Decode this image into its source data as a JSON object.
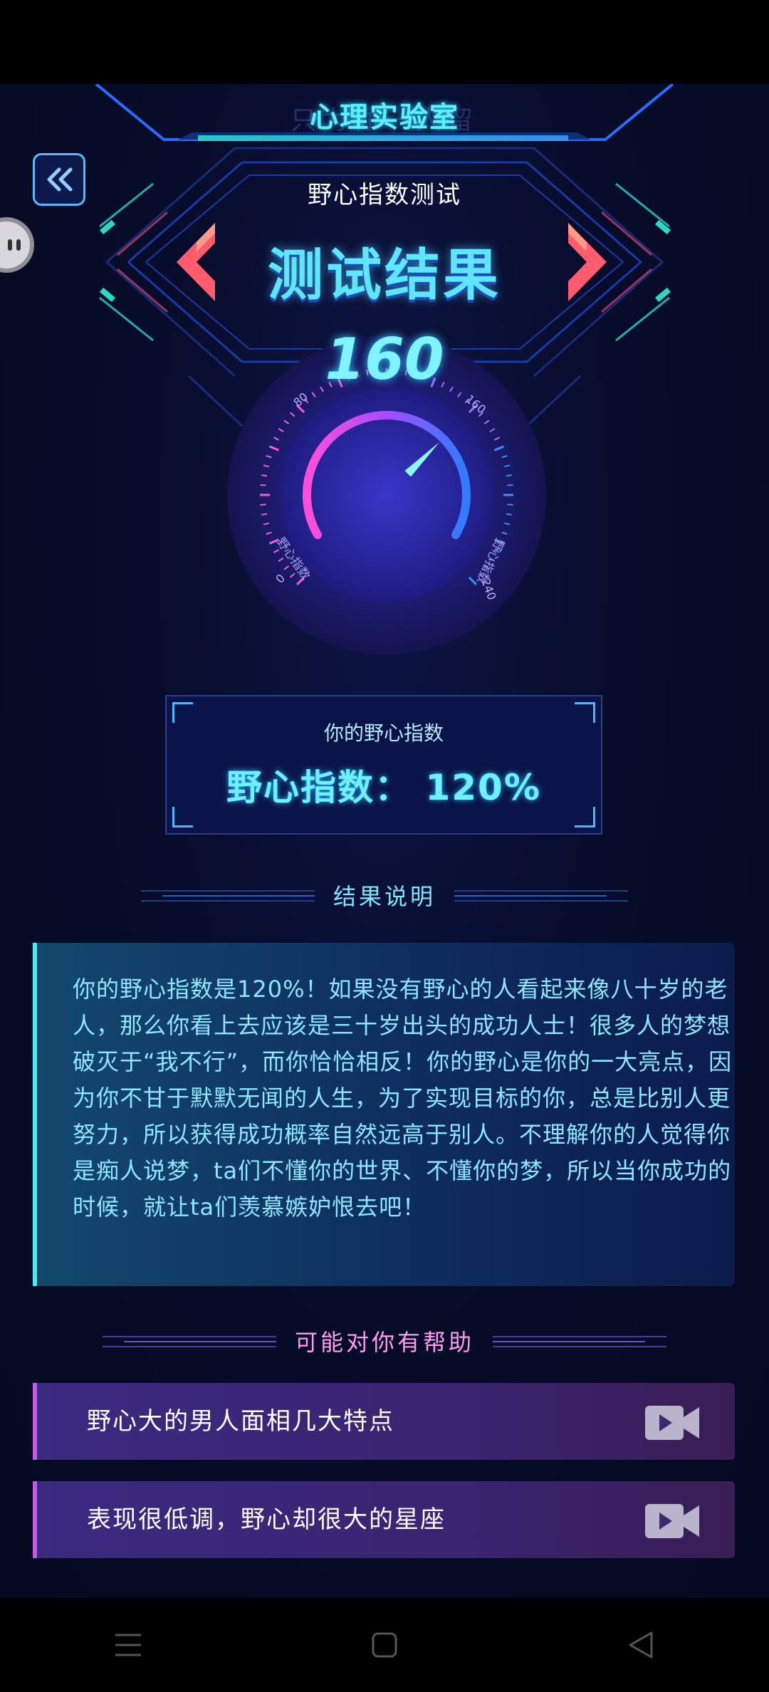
{
  "header": {
    "lab_title": "心理实验室",
    "lab_ghost": "只为你一人留",
    "test_name": "野心指数测试",
    "result_title": "测试结果"
  },
  "icons": {
    "back": "double-chevron-left-icon",
    "prev": "chevron-left-icon",
    "next": "chevron-right-icon",
    "video": "video-icon"
  },
  "gauge": {
    "value": "160",
    "tick_labels": [
      "0",
      "80",
      "160",
      "240"
    ],
    "left_caption": "野心指数",
    "right_caption": "野心指数",
    "needle_value": 160,
    "max": 240
  },
  "index_box": {
    "label": "你的野心指数",
    "value": "野心指数： 120%"
  },
  "result_section": {
    "heading": "结果说明",
    "text": "你的野心指数是120%！如果没有野心的人看起来像八十岁的老人，那么你看上去应该是三十岁出头的成功人士！很多人的梦想破灭于“我不行”，而你恰恰相反！你的野心是你的一大亮点，因为你不甘于默默无闻的人生，为了实现目标的你，总是比别人更努力，所以获得成功概率自然远高于别人。不理解你的人觉得你是痴人说梦，ta们不懂你的世界、不懂你的梦，所以当你成功的时候，就让ta们羡慕嫉妒恨去吧！"
  },
  "help_section": {
    "heading": "可能对你有帮助",
    "items": [
      {
        "title": "野心大的男人面相几大特点"
      },
      {
        "title": "表现很低调，野心却很大的星座"
      }
    ]
  },
  "colors": {
    "accent_cyan": "#5ee6ff",
    "accent_pink": "#ff5c8a",
    "accent_purple": "#c45ae8",
    "background": "#060b22"
  },
  "system_nav": {
    "menu": "menu-icon",
    "home": "home-icon",
    "back": "back-triangle-icon"
  }
}
